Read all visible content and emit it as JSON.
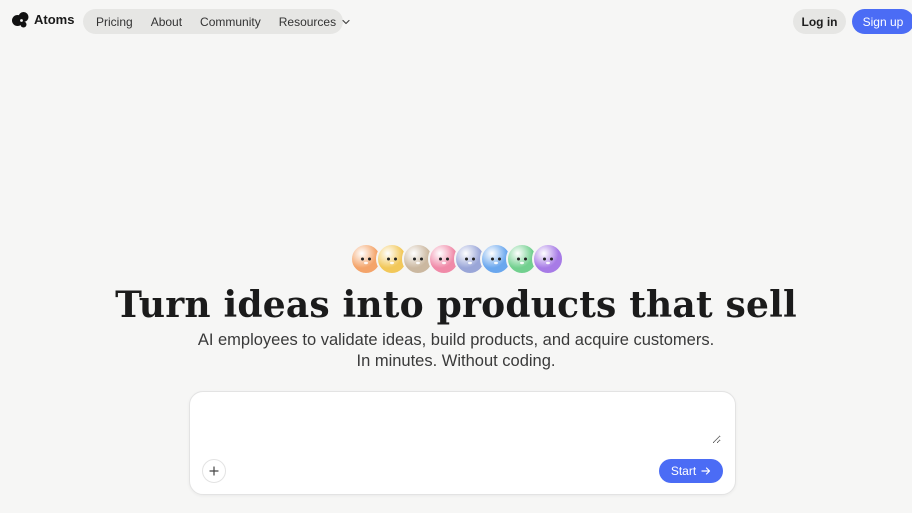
{
  "brand": {
    "name": "Atoms",
    "logo_icon": "atoms-logo-icon"
  },
  "nav": {
    "links": [
      "Pricing",
      "About",
      "Community",
      "Resources"
    ],
    "resources_icon": "chevron-down-icon"
  },
  "auth": {
    "login_label": "Log in",
    "signup_label": "Sign up"
  },
  "avatars": {
    "count": 8,
    "colors": [
      "#f4a46a",
      "#f2c85a",
      "#cbb8a0",
      "#f08aa8",
      "#9aa6d8",
      "#6aa7ee",
      "#72d08f",
      "#a77be6"
    ]
  },
  "hero": {
    "title": "Turn ideas into products that sell",
    "subtitle_line1": "AI employees to validate ideas, build products, and acquire customers.",
    "subtitle_line2": "In minutes. Without coding."
  },
  "prompt": {
    "placeholder": "",
    "add_icon": "plus-icon",
    "start_label": "Start",
    "start_icon": "arrow-right-icon"
  },
  "colors": {
    "accent": "#4b6cf5",
    "background": "#f6f6f5"
  }
}
